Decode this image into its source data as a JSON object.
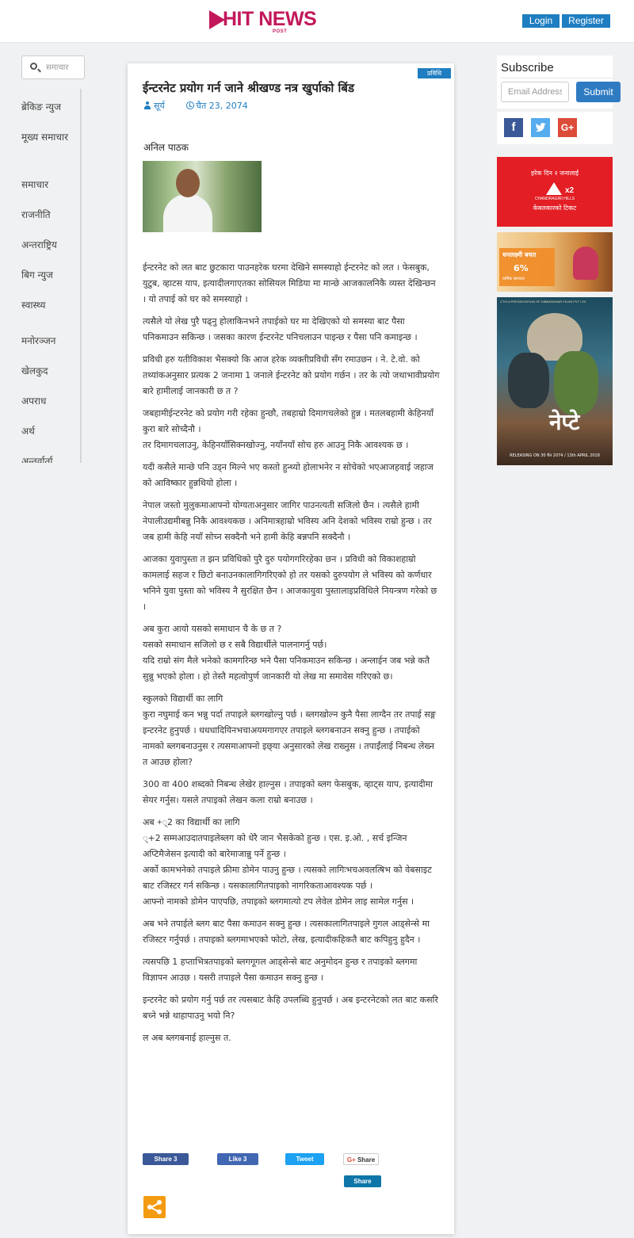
{
  "header": {
    "logo_text": "HIT NEWS",
    "logo_sub": "POST",
    "login_label": "Login",
    "register_label": "Register"
  },
  "sidebar": {
    "search_placeholder": "समाचार",
    "items": [
      {
        "label": "ब्रेकिङ न्युज"
      },
      {
        "label": "मूख्य समाचार"
      },
      {
        "label": "समाचार"
      },
      {
        "label": "राजनीति"
      },
      {
        "label": "अन्तराष्ट्रिय"
      },
      {
        "label": "बिग न्युज"
      },
      {
        "label": "स्वास्थ्य"
      },
      {
        "label": "मनोरञ्जन"
      },
      {
        "label": "खेलकुद"
      },
      {
        "label": "अपराध"
      },
      {
        "label": "अर्थ"
      },
      {
        "label": "अन्तर्वार्ता"
      }
    ]
  },
  "article": {
    "category": "प्रविधि",
    "title": "ईन्टरनेट प्रयोग गर्न जाने श्रीखण्ड नत्र खुर्पाको बिंड",
    "author": "सूर्य",
    "date": "चैत 23, 2074",
    "byline": "अनिल पाठक",
    "paragraphs": [
      "ईन्टरनेट को लत बाट छुटकारा पाउनहरेक घरमा देखिने समस्याहो ईन्टरनेट को लत । फेसबुक, युटुब, व्हाटस याप, इत्यादीलगाएतका सोसियल मिडिया मा मान्छे आजकालनिकै व्यस्त देखिन्छन । यो तपाई को घर को समस्याहो ।",
      "त्यसैले यो लेख पुरै पढ्‌नु होलाकिनभने तपाईको घर मा देखिएको यो समस्या बाट पैसा पनिकमाउन सकिन्छ । जसका कारण ईन्टरनेट पनिचलाउन पाइन्छ र पैसा पनि कमाइन्छ ।",
      "प्रविधी हरु यतीविकाश भैसक्यो कि आज हरेक व्यक्तीप्रविधी सँग रमाउछन । ने. टे.वो. को तथ्यांकअनुसार प्रत्यक 2 जनामा 1 जनाले ईन्टरनेट को प्रयोग गर्छन । तर के त्यो जथाभावीप्रयोग बारे हामीलाई जानकारी छ त ?",
      "जबहामीईन्टरनेट को प्रयोग गरी रहेका हुन्छौ, तबहाम्रो दिमागचलेको हुन्न । मतलबहामी केहिनयाँ कुरा बारे सोच्दैनौ ।\nतर दिमागचलाउनु, केहिनयाँसिक्नखोज्नु, नयाँनयाँ सोच हरु आउनु निकै आवश्यक छ ।",
      "यदी कसैले मान्छे पनि उड्‌न मिल्ने भए कस्तो हुन्थ्यो होलाभनेर न सोचेको भएआजहवाई जहाज को आविष्कार हुन्नथियो होला ।",
      "नेपाल जस्तो मुलुकमाआफ्नो योग्यताअनुसार जागिर पाउनत्यती सजिलो छैन । त्यसैले हामी नेपालीउद्यमीबन्नु निकै आवश्यकछ । अनिमात्रहाम्रो भविस्य अनि देशको भविस्य राम्रो हुन्छ । तर जब हामी केहि नयाँ सोच्न सक्दैनौ भने हामी केहि बन्नपनि सक्दैनौ ।",
      "आजका युवापुस्ता त झन प्रविधिको पुरै दुरु पयोगगरिरहेका छन । प्रविधी को विकाशहाम्रो कामलाई सहज र छिटो बनाउनकालागिगरिएको हो तर यसको दुरुपयोग ले भविस्य को कर्णधार भनिने युवा पुस्ता को भविस्य नै सुरक्षित छैन । आजकायुवा पुस्तालाइप्रविधिले नियन्त्रण गरेको छ ।",
      "अब कुरा आयो यसको समाधान चै के छ त ?\nयसको समाधान सजिलो छ र सबै विद्यार्थीले पालनागर्नु पर्छ।\nयदि राम्रो संग मैले भनेको कामगरिन्छ भने पैसा पनिकमाउन सकिन्छ । अन्लाईन जब भन्ने कतै सुन्नु भएको होला । हो तेस्तै महत्वोपुर्ण जानकारी यो लेख मा समावेस गरिएको छ।",
      "स्कुलको विद्यार्थी का लागि\nकुरा नघुमाई कन भन्नु पर्दा तपाइले ब्लगखोल्नु पर्छ । ब्लगखोल्न कुनै पैसा लाग्दैन तर तपाई सङ्ग इन्टरनेट हुनुपर्छ । धधधादियिनभचाअयमगागएर तपाइले ब्लगबनाउन सक्नु हुन्छ । तपाईको नामको ब्लगबनाउनुस र त्यसमाआफ्नो इछ्‌या अनुसारको लेख राख्नुस । तपाईंलाई निबन्ध लेख्न त आउछ होला?",
      "300 वा 400 शब्दको निबन्ध लेखेर हाल्नुस । तपाइको ब्लग फेसबुक, व्हाट्‌स याप, इत्यादीमा सेयर गर्नुस। यसले तपाइको लेखन कला राम्रो बनाउछ ।",
      "अब +्2 का विद्यार्थी का लागि\n्+2 सम्मआउदातपाइलेब्लग को धेरै जान भैसकेको हुन्छ । एस. इ.ओ. , सर्च इन्जिन अप्टिमैजेसन इत्यादी को बारेमाजान्नु पर्ने हुन्छ ।\nअर्को कामभनेको तपाइले फ्रीमा डोमेन पाउनु हुन्छ । त्यसको लागिःभचअवलत्षिभ को वेबसाइट बाट रजिस्टर गर्न सकिन्छ । यसकालागितपाइको नागरिकताआवश्यक पर्छ ।\nआफ्नो नामको डोमेन पाएपछि, तपाइको ब्लगमात्यो टप लेवेल डोमेन लाइ सामेल गर्नुस ।",
      "अब भने तपाईले ब्लग बाट पैसा कमाउन सक्नु हुन्छ । त्यसकालागितपाइले गुगल आड्‌सेन्से मा रजिस्टर गर्नुपर्छ । तपाइको ब्लगमाभएको फोटो, लेख, इत्यादीकहिकतै बाट कपिहुनु हुदैन ।",
      "त्यसपछि 1 हप्ताभित्रतपाइको ब्लगगूगल आड्‌सेन्से बाट अनुमोदन हुन्छ र तपाइको ब्लगमा विज्ञापन आउछ । यसरी तपाइले पैसा कमाउन सक्नु हुन्छ ।",
      "इन्टरनेट को प्रयोग गर्नु पर्छ तर त्यसबाट केहि उपलब्धि हुनुपर्छ । अब इन्टरनेटको लत बाट कसरि बच्ने भन्ने थाहापाउनु भयो नि?",
      "ल अब ब्लगबनाई हाल्नुस त."
    ],
    "share": {
      "facebook": "Share 3",
      "like": "Like 3",
      "tweet": "Tweet",
      "gplus": "Share",
      "linkedin": "Share"
    }
  },
  "subscribe": {
    "title": "Subscribe",
    "email_placeholder": "Email Address",
    "submit_label": "Submit"
  },
  "social": {
    "facebook": "f",
    "gplus": "G+"
  },
  "ads": {
    "ad1_top": "हरेक दिन २ जनालाई",
    "ad1_x2": "x2",
    "ad1_brand": "CHANDRAGIRI HILLS",
    "ad1_bottom": "केबलकारको टिकट",
    "ad2_head": "धनलक्ष्मी बचत",
    "ad2_pct": "6%",
    "ad2_sub": "वार्षिक ब्याजदर",
    "ad3_top": "CTIS A PRESENTATION OF  DIBBASHMAR FILMS PVT LTD",
    "ad3_title": "नेप्टे",
    "ad3_date": "RELEASING ON 30 चैत 2074 / 13th APRIL 2018"
  },
  "colors": {
    "brand": "#c2185b",
    "accent": "#1f7ec1",
    "share_fab": "#f39c12"
  }
}
